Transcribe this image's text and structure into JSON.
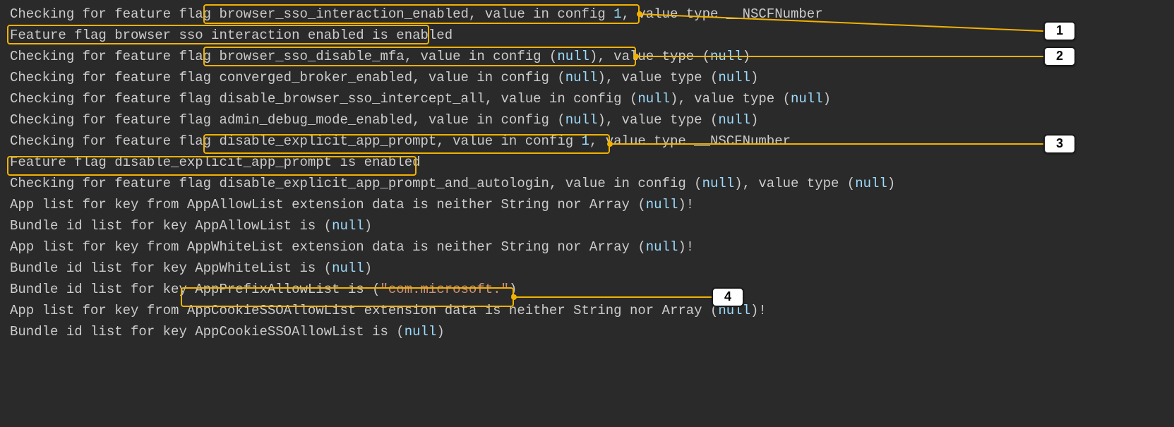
{
  "log": {
    "l1_prefix": "Checking for feature flag ",
    "l1_hl": "browser_sso_interaction_enabled, value in config ",
    "l1_num": "1",
    "l1_suffix": ", value type __NSCFNumber",
    "l2_hl": "Feature flag browser sso interaction enabled is enabled",
    "l3_prefix": "Checking for feature flag ",
    "l3_hl_a": "browser_sso_disable_mfa, value in config (",
    "l3_null1": "null",
    "l3_hl_b": ")",
    "l3_suffix_a": ", value type (",
    "l3_null2": "null",
    "l3_suffix_b": ")",
    "l4_prefix": "Checking for feature flag converged_broker_enabled, value in config (",
    "l4_null1": "null",
    "l4_mid": "), value type (",
    "l4_null2": "null",
    "l4_end": ")",
    "l5_prefix": "Checking for feature flag disable_browser_sso_intercept_all, value in config (",
    "l5_null1": "null",
    "l5_mid": "), value type (",
    "l5_null2": "null",
    "l5_end": ")",
    "l6_prefix": "Checking for feature flag admin_debug_mode_enabled, value in config (",
    "l6_null1": "null",
    "l6_mid": "), value type (",
    "l6_null2": "null",
    "l6_end": ")",
    "l7_prefix": "Checking for feature flag ",
    "l7_hl": "disable_explicit_app_prompt, value in config ",
    "l7_num": "1",
    "l7_suffix": ", value type __NSCFNumber",
    "l8_hl": "Feature flag disable_explicit_app_prompt is enabled",
    "l9_prefix": "Checking for feature flag disable_explicit_app_prompt_and_autologin, value in config (",
    "l9_null1": "null",
    "l9_mid": "), value type (",
    "l9_null2": "null",
    "l9_end": ")",
    "l10_prefix": "App list for key from AppAllowList extension data is neither String nor Array (",
    "l10_null": "null",
    "l10_end": ")!",
    "l11_prefix": "Bundle id list for key AppAllowList is (",
    "l11_null": "null",
    "l11_end": ")",
    "l12_prefix": "App list for key from AppWhiteList extension data is neither String nor Array (",
    "l12_null": "null",
    "l12_end": ")!",
    "l13_prefix": "Bundle id list for key AppWhiteList is (",
    "l13_null": "null",
    "l13_end": ")",
    "l14_prefix": "Bundle id list for key ",
    "l14_hl_a": "AppPrefixAllowList is (",
    "l14_str": "\"com.microsoft.\"",
    "l14_hl_b": ")",
    "l15_prefix": "App list for key from AppCookieSSOAllowList extension data is neither String nor Array (",
    "l15_null": "null",
    "l15_end": ")!",
    "l16_prefix": "Bundle id list for key AppCookieSSOAllowList is (",
    "l16_null": "null",
    "l16_end": ")"
  },
  "callouts": {
    "c1": "1",
    "c2": "2",
    "c3": "3",
    "c4": "4"
  }
}
